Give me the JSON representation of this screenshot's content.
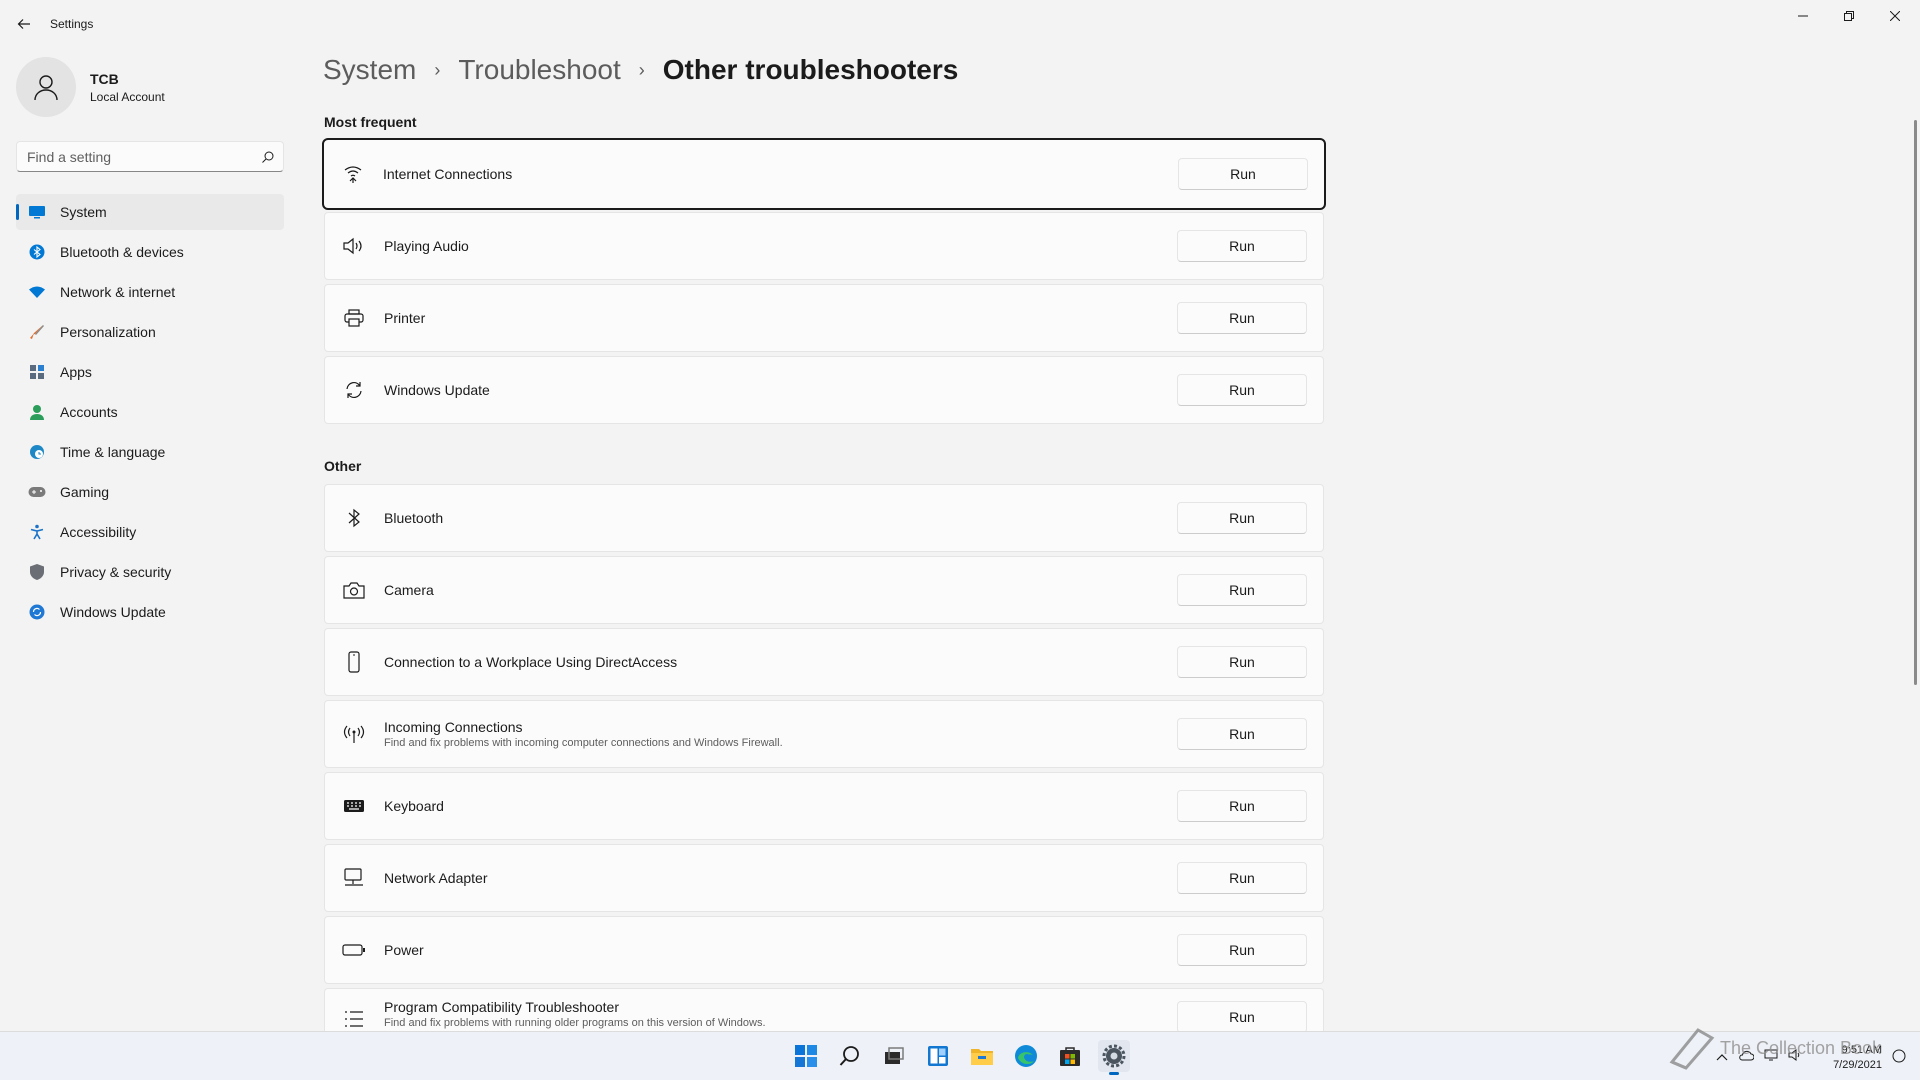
{
  "window": {
    "title": "Settings"
  },
  "profile": {
    "name": "TCB",
    "subtitle": "Local Account"
  },
  "search": {
    "placeholder": "Find a setting"
  },
  "nav": {
    "items": [
      {
        "label": "System",
        "icon": "display-icon",
        "color": "#0078d4",
        "active": true
      },
      {
        "label": "Bluetooth & devices",
        "icon": "bluetooth-icon",
        "color": "#0078d4"
      },
      {
        "label": "Network & internet",
        "icon": "wifi-icon",
        "color": "#0078d4"
      },
      {
        "label": "Personalization",
        "icon": "brush-icon",
        "color": "#e06c2c"
      },
      {
        "label": "Apps",
        "icon": "apps-icon",
        "color": "#5a6b80"
      },
      {
        "label": "Accounts",
        "icon": "person-icon",
        "color": "#2a9d5a"
      },
      {
        "label": "Time & language",
        "icon": "globe-clock-icon",
        "color": "#1e88c6"
      },
      {
        "label": "Gaming",
        "icon": "gamepad-icon",
        "color": "#7a7a7a"
      },
      {
        "label": "Accessibility",
        "icon": "accessibility-icon",
        "color": "#1a73c8"
      },
      {
        "label": "Privacy & security",
        "icon": "shield-icon",
        "color": "#6b6f75"
      },
      {
        "label": "Windows Update",
        "icon": "refresh-icon",
        "color": "#1e78d4"
      }
    ]
  },
  "breadcrumb": {
    "items": [
      "System",
      "Troubleshoot"
    ],
    "current": "Other troubleshooters"
  },
  "sections": {
    "frequent": {
      "title": "Most frequent",
      "items": [
        {
          "title": "Internet Connections",
          "icon": "wifi-signal-icon"
        },
        {
          "title": "Playing Audio",
          "icon": "speaker-icon"
        },
        {
          "title": "Printer",
          "icon": "printer-icon"
        },
        {
          "title": "Windows Update",
          "icon": "sync-icon"
        }
      ]
    },
    "other": {
      "title": "Other",
      "items": [
        {
          "title": "Bluetooth",
          "icon": "bluetooth-icon"
        },
        {
          "title": "Camera",
          "icon": "camera-icon"
        },
        {
          "title": "Connection to a Workplace Using DirectAccess",
          "icon": "device-icon"
        },
        {
          "title": "Incoming Connections",
          "desc": "Find and fix problems with incoming computer connections and Windows Firewall.",
          "icon": "antenna-icon"
        },
        {
          "title": "Keyboard",
          "icon": "keyboard-icon"
        },
        {
          "title": "Network Adapter",
          "icon": "monitor-network-icon"
        },
        {
          "title": "Power",
          "icon": "battery-icon"
        },
        {
          "title": "Program Compatibility Troubleshooter",
          "desc": "Find and fix problems with running older programs on this version of Windows.",
          "icon": "list-icon"
        }
      ]
    }
  },
  "run_label": "Run",
  "taskbar": {
    "apps": [
      "start-icon",
      "search-icon",
      "task-view-icon",
      "widgets-icon",
      "file-explorer-icon",
      "edge-icon",
      "store-icon",
      "settings-icon"
    ],
    "clock": {
      "time": "9:51 AM",
      "date": "7/29/2021"
    }
  },
  "watermark": {
    "text": "The Collection Book"
  },
  "colors": {
    "accent": "#0067c0",
    "background": "#f3f3f3",
    "card": "#fbfbfb"
  }
}
